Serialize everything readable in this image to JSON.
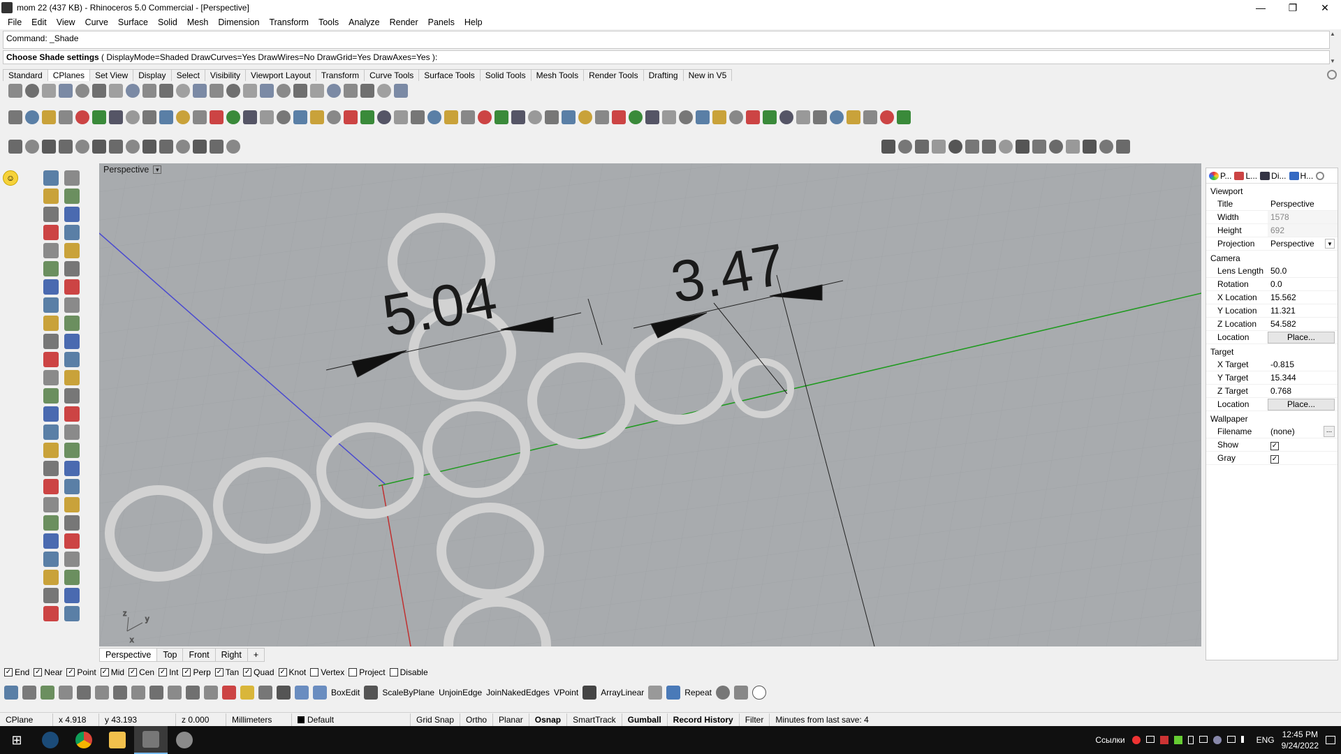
{
  "window": {
    "title": "mom 22 (437 KB) - Rhinoceros 5.0 Commercial - [Perspective]"
  },
  "menu": [
    "File",
    "Edit",
    "View",
    "Curve",
    "Surface",
    "Solid",
    "Mesh",
    "Dimension",
    "Transform",
    "Tools",
    "Analyze",
    "Render",
    "Panels",
    "Help"
  ],
  "command": {
    "history": "Command: _Shade",
    "prompt_label": "Choose Shade settings",
    "prompt_options": "( DisplayMode=Shaded  DrawCurves=Yes  DrawWires=No  DrawGrid=Yes  DrawAxes=Yes ):"
  },
  "toolbar_tabs": [
    "Standard",
    "CPlanes",
    "Set View",
    "Display",
    "Select",
    "Visibility",
    "Viewport Layout",
    "Transform",
    "Curve Tools",
    "Surface Tools",
    "Solid Tools",
    "Mesh Tools",
    "Render Tools",
    "Drafting",
    "New in V5"
  ],
  "active_toolbar_tab": "CPlanes",
  "viewport": {
    "label": "Perspective",
    "dimension_1": "5.04",
    "dimension_2": "3.47",
    "axis_z": "z",
    "axis_y": "y",
    "axis_x": "x"
  },
  "viewport_tabs": [
    "Perspective",
    "Top",
    "Front",
    "Right",
    "+"
  ],
  "osnap": [
    {
      "label": "End",
      "checked": true
    },
    {
      "label": "Near",
      "checked": true
    },
    {
      "label": "Point",
      "checked": true
    },
    {
      "label": "Mid",
      "checked": true
    },
    {
      "label": "Cen",
      "checked": true
    },
    {
      "label": "Int",
      "checked": true
    },
    {
      "label": "Perp",
      "checked": true
    },
    {
      "label": "Tan",
      "checked": true
    },
    {
      "label": "Quad",
      "checked": true
    },
    {
      "label": "Knot",
      "checked": true
    },
    {
      "label": "Vertex",
      "checked": false
    },
    {
      "label": "Project",
      "checked": false
    },
    {
      "label": "Disable",
      "checked": false
    }
  ],
  "bottom_tools": {
    "boxedit": "BoxEdit",
    "scalebyplane": "ScaleByPlane",
    "unjoinedge": "UnjoinEdge",
    "joinnakededges": "JoinNakedEdges",
    "vpoint": "VPoint",
    "arraylinear": "ArrayLinear",
    "repeat": "Repeat"
  },
  "status": {
    "cplane": "CPlane",
    "x": "x 4.918",
    "y": "y 43.193",
    "z": "z 0.000",
    "units": "Millimeters",
    "layer": "Default",
    "gridsnap": "Grid Snap",
    "ortho": "Ortho",
    "planar": "Planar",
    "osnap": "Osnap",
    "smarttrack": "SmartTrack",
    "gumball": "Gumball",
    "recordhistory": "Record History",
    "filter": "Filter",
    "lastsave": "Minutes from last save: 4"
  },
  "panel": {
    "tabs": [
      "P...",
      "L...",
      "Di...",
      "H..."
    ],
    "viewport_section": "Viewport",
    "rows_viewport": [
      {
        "k": "Title",
        "v": "Perspective"
      },
      {
        "k": "Width",
        "v": "1578",
        "gray": true
      },
      {
        "k": "Height",
        "v": "692",
        "gray": true
      },
      {
        "k": "Projection",
        "v": "Perspective"
      }
    ],
    "camera_section": "Camera",
    "rows_camera": [
      {
        "k": "Lens Length",
        "v": "50.0"
      },
      {
        "k": "Rotation",
        "v": "0.0"
      },
      {
        "k": "X Location",
        "v": "15.562"
      },
      {
        "k": "Y Location",
        "v": "11.321"
      },
      {
        "k": "Z Location",
        "v": "54.582"
      },
      {
        "k": "Location",
        "v": "Place...",
        "btn": true
      }
    ],
    "target_section": "Target",
    "rows_target": [
      {
        "k": "X Target",
        "v": "-0.815"
      },
      {
        "k": "Y Target",
        "v": "15.344"
      },
      {
        "k": "Z Target",
        "v": "0.768"
      },
      {
        "k": "Location",
        "v": "Place...",
        "btn": true
      }
    ],
    "wallpaper_section": "Wallpaper",
    "wallpaper_filename_k": "Filename",
    "wallpaper_filename_v": "(none)",
    "wallpaper_show": "Show",
    "wallpaper_gray": "Gray",
    "ellipsis": "..."
  },
  "taskbar": {
    "language": "ENG",
    "links": "Ссылки",
    "time": "12:45 PM",
    "date": "9/24/2022"
  }
}
